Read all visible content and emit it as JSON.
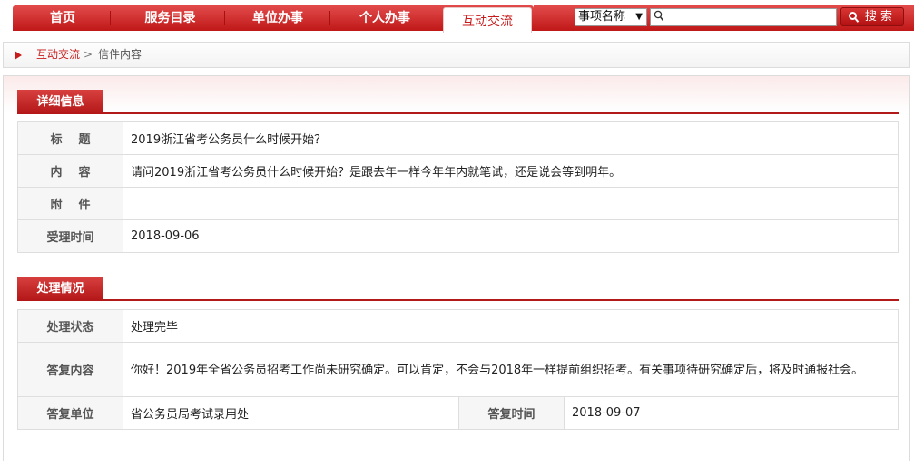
{
  "nav": {
    "items": [
      "首页",
      "服务目录",
      "单位办事",
      "个人办事",
      "互动交流"
    ],
    "active": "互动交流"
  },
  "search": {
    "select_value": "事项名称",
    "input_value": "",
    "button_label": "搜 索"
  },
  "breadcrumb": {
    "link": "互动交流",
    "separator": ">",
    "current": "信件内容"
  },
  "detail": {
    "section_title": "详细信息",
    "rows": [
      {
        "label": "标题",
        "value": "2019浙江省考公务员什么时候开始？"
      },
      {
        "label": "内容",
        "value": "请问2019浙江省考公务员什么时候开始？是跟去年一样今年年内就笔试，还是说会等到明年。"
      },
      {
        "label": "附件",
        "value": ""
      },
      {
        "label": "受理时间",
        "value": "2018-09-06"
      }
    ]
  },
  "handling": {
    "section_title": "处理情况",
    "status_label": "处理状态",
    "status_value": "处理完毕",
    "reply_label": "答复内容",
    "reply_value": "你好！2019年全省公务员招考工作尚未研究确定。可以肯定，不会与2018年一样提前组织招考。有关事项待研究确定后，将及时通报社会。",
    "unit_label": "答复单位",
    "unit_value": "省公务员局考试录用处",
    "time_label": "答复时间",
    "time_value": "2018-09-07"
  },
  "colors": {
    "brand_red": "#c81a1a",
    "label_bg": "#f6f6f6",
    "border": "#dedede"
  },
  "icons": [
    "search-icon",
    "dropdown-arrow-icon",
    "breadcrumb-arrow-icon"
  ]
}
